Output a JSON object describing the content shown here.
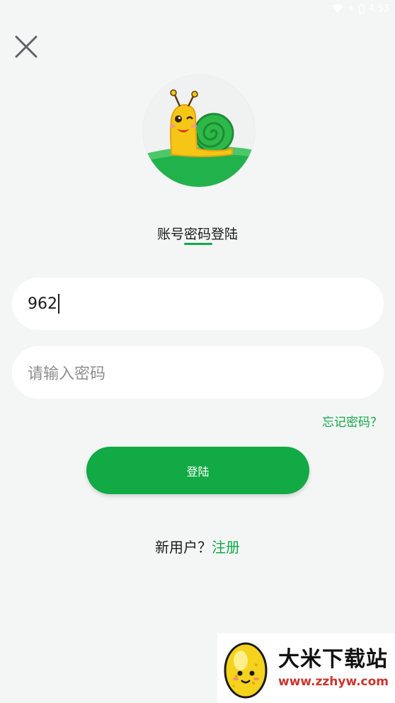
{
  "status_bar": {
    "time": "4:53",
    "icons": [
      "wifi-icon",
      "signal-icon",
      "battery-icon"
    ]
  },
  "header": {
    "close_icon": "close-icon"
  },
  "avatar": {
    "icon": "snail-mascot-icon"
  },
  "login_mode": {
    "label": "账号密码登陆"
  },
  "form": {
    "account_value": "962",
    "password_placeholder": "请输入密码",
    "forgot_label": "忘记密码？",
    "submit_label": "登陆"
  },
  "register": {
    "prompt": "新用户？",
    "link_label": "注册"
  },
  "watermark": {
    "title": "大米下载站",
    "url": "www.zzhyw.com",
    "logo_icon": "egg-mascot-icon"
  },
  "colors": {
    "accent": "#11aa44",
    "background": "#f4f6f5",
    "url_red": "#c8362e"
  }
}
